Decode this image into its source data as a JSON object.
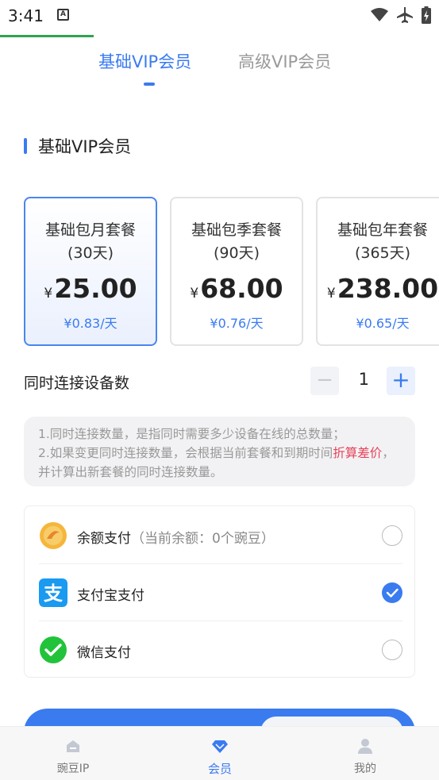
{
  "status_bar": {
    "time": "3:41",
    "notification_icon_letter": "A",
    "icons": [
      "wifi-icon",
      "airplane-icon",
      "battery-charging-icon"
    ]
  },
  "tabs": [
    {
      "label": "基础VIP会员",
      "active": true
    },
    {
      "label": "高级VIP会员",
      "active": false
    }
  ],
  "section": {
    "title": "基础VIP会员"
  },
  "plans": [
    {
      "name": "基础包月套餐",
      "days": "(30天)",
      "currency": "¥",
      "price": "25.00",
      "per_day": "¥0.83/天",
      "selected": true
    },
    {
      "name": "基础包季套餐",
      "days": "(90天)",
      "currency": "¥",
      "price": "68.00",
      "per_day": "¥0.76/天",
      "selected": false
    },
    {
      "name": "基础包年套餐",
      "days": "(365天)",
      "currency": "¥",
      "price": "238.00",
      "per_day": "¥0.65/天",
      "selected": false
    }
  ],
  "devices": {
    "label": "同时连接设备数",
    "value": "1",
    "minus": "−",
    "plus": "+"
  },
  "notice": {
    "line1": "1.同时连接数量，是指同时需要多少设备在线的总数量；",
    "line2_before": "2.如果变更同时连接数量，会根据当前套餐和到期时间",
    "line2_highlight": "折算差价",
    "line2_after": "，并计算出新套餐的同时连接数量。"
  },
  "payment": {
    "options": [
      {
        "label": "余额支付",
        "hint": "（当前余额：0个豌豆）",
        "icon": "balance-coin-icon",
        "checked": false
      },
      {
        "label": "支付宝支付",
        "hint": "",
        "icon": "alipay-icon",
        "checked": true
      },
      {
        "label": "微信支付",
        "hint": "",
        "icon": "wechat-icon",
        "checked": false
      }
    ]
  },
  "bottom_nav": [
    {
      "label": "豌豆IP",
      "icon": "home-icon",
      "active": false
    },
    {
      "label": "会员",
      "icon": "diamond-icon",
      "active": true
    },
    {
      "label": "我的",
      "icon": "user-icon",
      "active": false
    }
  ],
  "colors": {
    "accent": "#3a7bf0",
    "highlight_red": "#e8425a",
    "progress_green": "#2ea44f"
  }
}
